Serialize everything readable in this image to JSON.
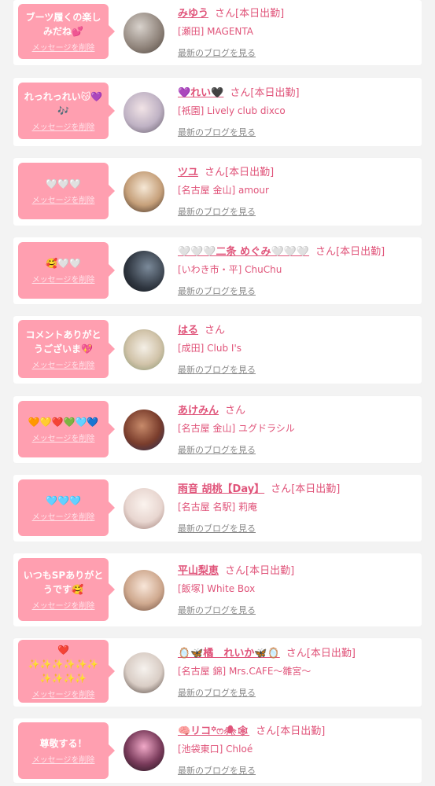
{
  "delete_label": "メッセージを削除",
  "san_label": "さん",
  "blog_label": "最新のブログを見る",
  "colors": {
    "bubble": "#ff9fb0",
    "name": "#e0547a",
    "blog_link": "#8a8a8a",
    "card": "#ffffff",
    "background": "#f3f3f3"
  },
  "cards": [
    {
      "message": "ブーツ履くの楽しみだね💕",
      "name": "みゆう",
      "status": "[本日出勤]",
      "shop": "[瀬田] MAGENTA"
    },
    {
      "message": "れっれっれい😽💜🎶",
      "name": "💜れい🖤",
      "status": "[本日出勤]",
      "shop": "[祇園] Lively club dixco"
    },
    {
      "message": "🤍🤍🤍",
      "name": "ツユ",
      "status": "[本日出勤]",
      "shop": "[名古屋 金山] amour"
    },
    {
      "message": "🥰🤍🤍",
      "name": "🤍🤍🤍二条 めぐみ🤍🤍🤍",
      "status": "[本日出勤]",
      "shop": "[いわき市・平] ChuChu"
    },
    {
      "message": "コメントありがとうございま💖",
      "name": "はる",
      "status": "",
      "shop": "[成田] Club I's"
    },
    {
      "message": "🧡💛❤️💚🩵💙",
      "name": "あけみん",
      "status": "",
      "shop": "[名古屋 金山] ユグドラシル"
    },
    {
      "message": "🩵🩵🩵",
      "name": "雨音 胡桃【Day】",
      "status": "[本日出勤]",
      "shop": "[名古屋 名駅] 莉庵"
    },
    {
      "message": "いつもSPありがとうです🥰",
      "name": "平山梨恵",
      "status": "[本日出勤]",
      "shop": "[飯塚] White Box"
    },
    {
      "message": "❤️\n✨✨✨✨✨✨\n✨✨✨✨",
      "name": "🪞🦋橘　れいか🦋🪞",
      "status": "[本日出勤]",
      "shop": "[名古屋 錦] Mrs.CAFE～雛宮～"
    },
    {
      "message": "尊敬する！",
      "name": "🧠リコ꙳ෆ🕷🕸",
      "status": "[本日出勤]",
      "shop": "[池袋東口] Chloé"
    }
  ]
}
